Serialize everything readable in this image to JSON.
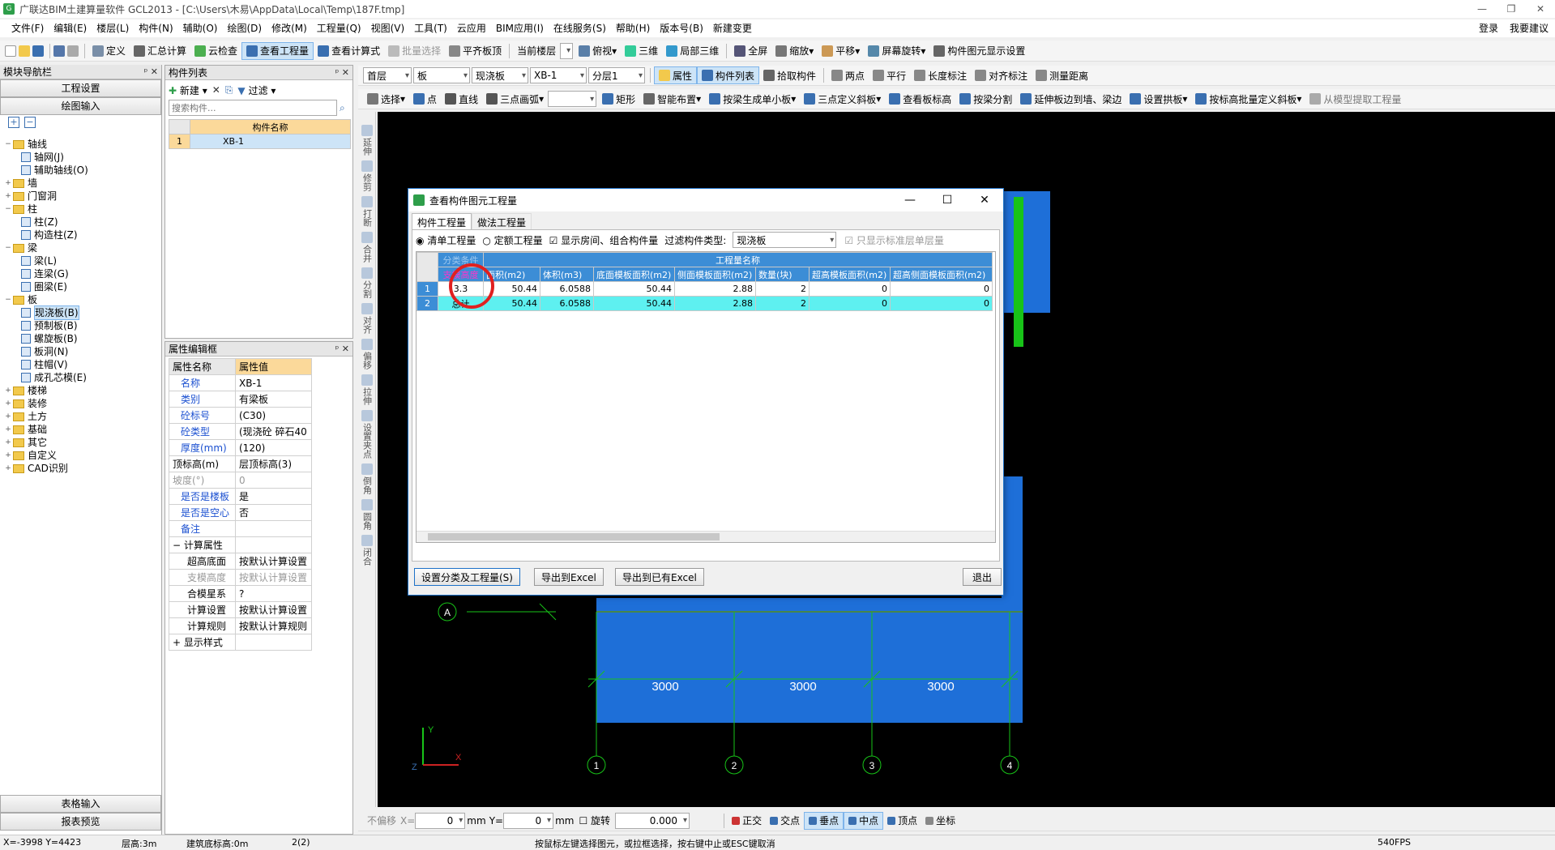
{
  "title": "广联达BIM土建算量软件 GCL2013 - [C:\\Users\\木易\\AppData\\Local\\Temp\\187F.tmp]",
  "window_controls": {
    "min": "—",
    "max": "❐",
    "close": "✕"
  },
  "menu": [
    "文件(F)",
    "编辑(E)",
    "楼层(L)",
    "构件(N)",
    "辅助(O)",
    "绘图(D)",
    "修改(M)",
    "工程量(Q)",
    "视图(V)",
    "工具(T)",
    "云应用",
    "BIM应用(I)",
    "在线服务(S)",
    "帮助(H)",
    "版本号(B)",
    "新建变更"
  ],
  "menu_right": {
    "login": "登录",
    "help": "我要建议"
  },
  "toolbar1": [
    "定义",
    "汇总计算",
    "云检查",
    "查看工程量",
    "查看计算式",
    "批量选择",
    "平齐板顶",
    "当前楼层",
    "俯视",
    "三维",
    "局部三维",
    "全屏",
    "缩放",
    "平移",
    "屏幕旋转",
    "构件图元显示设置"
  ],
  "toolbar2": {
    "floor": "首层",
    "type": "板",
    "sub": "现浇板",
    "comp": "XB-1",
    "layer": "分层1",
    "buttons": [
      "属性",
      "构件列表",
      "拾取构件",
      "两点",
      "平行",
      "长度标注",
      "对齐标注",
      "测量距离"
    ]
  },
  "toolbar3": [
    "选择",
    "点",
    "直线",
    "三点画弧",
    "矩形",
    "智能布置",
    "按梁生成单小板",
    "三点定义斜板",
    "查看板标高",
    "按梁分割",
    "延伸板边到墙、梁边",
    "设置拱板",
    "按标高批量定义斜板",
    "从模型提取工程量"
  ],
  "nav": {
    "title": "模块导航栏",
    "btn1": "工程设置",
    "btn2": "绘图输入",
    "bottom1": "表格输入",
    "bottom2": "报表预览",
    "tree": [
      {
        "label": "轴线",
        "level": 0,
        "exp": "−",
        "type": "folder"
      },
      {
        "label": "轴网(J)",
        "level": 1,
        "type": "leaf"
      },
      {
        "label": "辅助轴线(O)",
        "level": 1,
        "type": "leaf"
      },
      {
        "label": "墙",
        "level": 0,
        "exp": "+",
        "type": "folder"
      },
      {
        "label": "门窗洞",
        "level": 0,
        "exp": "+",
        "type": "folder"
      },
      {
        "label": "柱",
        "level": 0,
        "exp": "−",
        "type": "folder"
      },
      {
        "label": "柱(Z)",
        "level": 1,
        "type": "leaf"
      },
      {
        "label": "构造柱(Z)",
        "level": 1,
        "type": "leaf"
      },
      {
        "label": "梁",
        "level": 0,
        "exp": "−",
        "type": "folder"
      },
      {
        "label": "梁(L)",
        "level": 1,
        "type": "leaf"
      },
      {
        "label": "连梁(G)",
        "level": 1,
        "type": "leaf"
      },
      {
        "label": "圈梁(E)",
        "level": 1,
        "type": "leaf"
      },
      {
        "label": "板",
        "level": 0,
        "exp": "−",
        "type": "folder"
      },
      {
        "label": "现浇板(B)",
        "level": 1,
        "type": "leaf",
        "selected": true
      },
      {
        "label": "预制板(B)",
        "level": 1,
        "type": "leaf"
      },
      {
        "label": "螺旋板(B)",
        "level": 1,
        "type": "leaf"
      },
      {
        "label": "板洞(N)",
        "level": 1,
        "type": "leaf"
      },
      {
        "label": "柱帽(V)",
        "level": 1,
        "type": "leaf"
      },
      {
        "label": "成孔芯模(E)",
        "level": 1,
        "type": "leaf"
      },
      {
        "label": "楼梯",
        "level": 0,
        "exp": "+",
        "type": "folder"
      },
      {
        "label": "装修",
        "level": 0,
        "exp": "+",
        "type": "folder"
      },
      {
        "label": "土方",
        "level": 0,
        "exp": "+",
        "type": "folder"
      },
      {
        "label": "基础",
        "level": 0,
        "exp": "+",
        "type": "folder"
      },
      {
        "label": "其它",
        "level": 0,
        "exp": "+",
        "type": "folder"
      },
      {
        "label": "自定义",
        "level": 0,
        "exp": "+",
        "type": "folder"
      },
      {
        "label": "CAD识别",
        "level": 0,
        "exp": "+",
        "type": "folder"
      }
    ]
  },
  "complist": {
    "title": "构件列表",
    "new": "新建",
    "filter": "过滤",
    "search_placeholder": "搜索构件...",
    "col": "构件名称",
    "rows": [
      {
        "no": "1",
        "name": "XB-1"
      }
    ]
  },
  "props": {
    "title": "属性编辑框",
    "col1": "属性名称",
    "col2": "属性值",
    "rows": [
      {
        "k": "名称",
        "v": "XB-1",
        "blue": true
      },
      {
        "k": "类别",
        "v": "有梁板",
        "blue": true
      },
      {
        "k": "砼标号",
        "v": "(C30)",
        "blue": true
      },
      {
        "k": "砼类型",
        "v": "(现浇砼 碎石40",
        "blue": true
      },
      {
        "k": "厚度(mm)",
        "v": "(120)",
        "blue": true
      },
      {
        "k": "顶标高(m)",
        "v": "层顶标高(3)",
        "blue": false
      },
      {
        "k": "坡度(°)",
        "v": "0",
        "blue": false,
        "grey": true
      },
      {
        "k": "是否是楼板",
        "v": "是",
        "blue": true
      },
      {
        "k": "是否是空心",
        "v": "否",
        "blue": true
      },
      {
        "k": "备注",
        "v": "",
        "blue": true
      },
      {
        "k": "计算属性",
        "v": "",
        "group": true,
        "exp": "−"
      },
      {
        "k": "超高底面",
        "v": "按默认计算设置",
        "indent": true
      },
      {
        "k": "支模高度",
        "v": "按默认计算设置",
        "indent": true,
        "grey": true
      },
      {
        "k": "合模星系",
        "v": "?",
        "indent": true
      },
      {
        "k": "计算设置",
        "v": "按默认计算设置",
        "indent": true
      },
      {
        "k": "计算规则",
        "v": "按默认计算规则",
        "indent": true
      },
      {
        "k": "显示样式",
        "v": "",
        "group": true,
        "exp": "+"
      }
    ]
  },
  "dialog": {
    "title": "查看构件图元工程量",
    "tabs": [
      "构件工程量",
      "做法工程量"
    ],
    "radio1": "清单工程量",
    "radio2": "定额工程量",
    "checkbox1": "显示房间、组合构件量",
    "filter_label": "过滤构件类型:",
    "filter_value": "现浇板",
    "checkbox2": "只显示标准层单层量",
    "header_group": "工程量名称",
    "header_cls": "分类条件",
    "cols": [
      "支模高度",
      "面积(m2)",
      "体积(m3)",
      "底面模板面积(m2)",
      "侧面模板面积(m2)",
      "数量(块)",
      "超高模板面积(m2)",
      "超高侧面模板面积(m2)"
    ],
    "rows": [
      {
        "no": "1",
        "c": [
          "3.3",
          "50.44",
          "6.0588",
          "50.44",
          "2.88",
          "2",
          "0",
          "0"
        ]
      },
      {
        "no": "2",
        "c": [
          "总计",
          "50.44",
          "6.0588",
          "50.44",
          "2.88",
          "2",
          "0",
          "0"
        ]
      }
    ],
    "buttons": {
      "set": "设置分类及工程量(S)",
      "export": "导出到Excel",
      "export2": "导出到已有Excel",
      "exit": "退出"
    }
  },
  "canvas": {
    "dims": [
      "3000",
      "3000",
      "3000"
    ],
    "axes_num": [
      "1",
      "2",
      "3",
      "4"
    ],
    "axis_a": "A",
    "ax_y": "Y",
    "ax_z": "Z",
    "ax_x": "X"
  },
  "bottombar": {
    "noshift": "不偏移",
    "x_label": "X=",
    "x_val": "0",
    "mm1": "mm",
    "y_label": "Y=",
    "y_val": "0",
    "mm2": "mm",
    "rotate": "旋转",
    "rot_val": "0.000",
    "snaps": [
      "正交",
      "交点",
      "垂点",
      "中点",
      "顶点",
      "坐标"
    ]
  },
  "status": {
    "coords": "X=-3998 Y=4423",
    "floor_h": "层高:3m",
    "base_h": "建筑底标高:0m",
    "count": "2(2)",
    "hint": "按鼠标左键选择图元，或拉框选择，按右键中止或ESC键取消",
    "fps": "540FPS"
  },
  "vtools": [
    "延伸",
    "修剪",
    "打断",
    "合并",
    "分割",
    "对齐",
    "偏移",
    "拉伸",
    "设置夹点",
    "倒角",
    "圆角",
    "闭合"
  ]
}
